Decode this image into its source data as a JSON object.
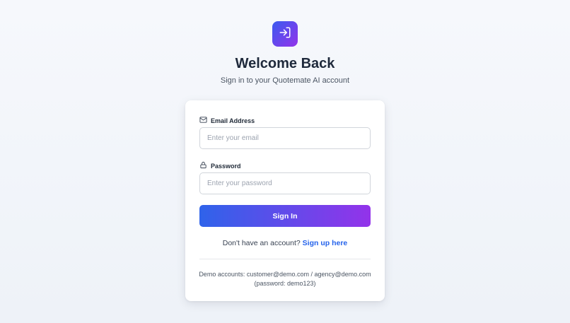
{
  "header": {
    "logo_icon": "sign-in-icon",
    "title": "Welcome Back",
    "subtitle": "Sign in to your Quotemate AI account"
  },
  "form": {
    "email": {
      "icon": "mail-icon",
      "label": "Email Address",
      "placeholder": "Enter your email",
      "value": ""
    },
    "password": {
      "icon": "lock-icon",
      "label": "Password",
      "placeholder": "Enter your password",
      "value": ""
    },
    "submit_label": "Sign In"
  },
  "signup": {
    "prompt": "Don't have an account?",
    "link_label": "Sign up here"
  },
  "demo": {
    "line1": "Demo accounts: customer@demo.com / agency@demo.com",
    "line2": "(password: demo123)"
  },
  "colors": {
    "accent_start": "#2f63ea",
    "accent_end": "#9333ea",
    "link": "#2563eb",
    "title": "#1e293b"
  }
}
